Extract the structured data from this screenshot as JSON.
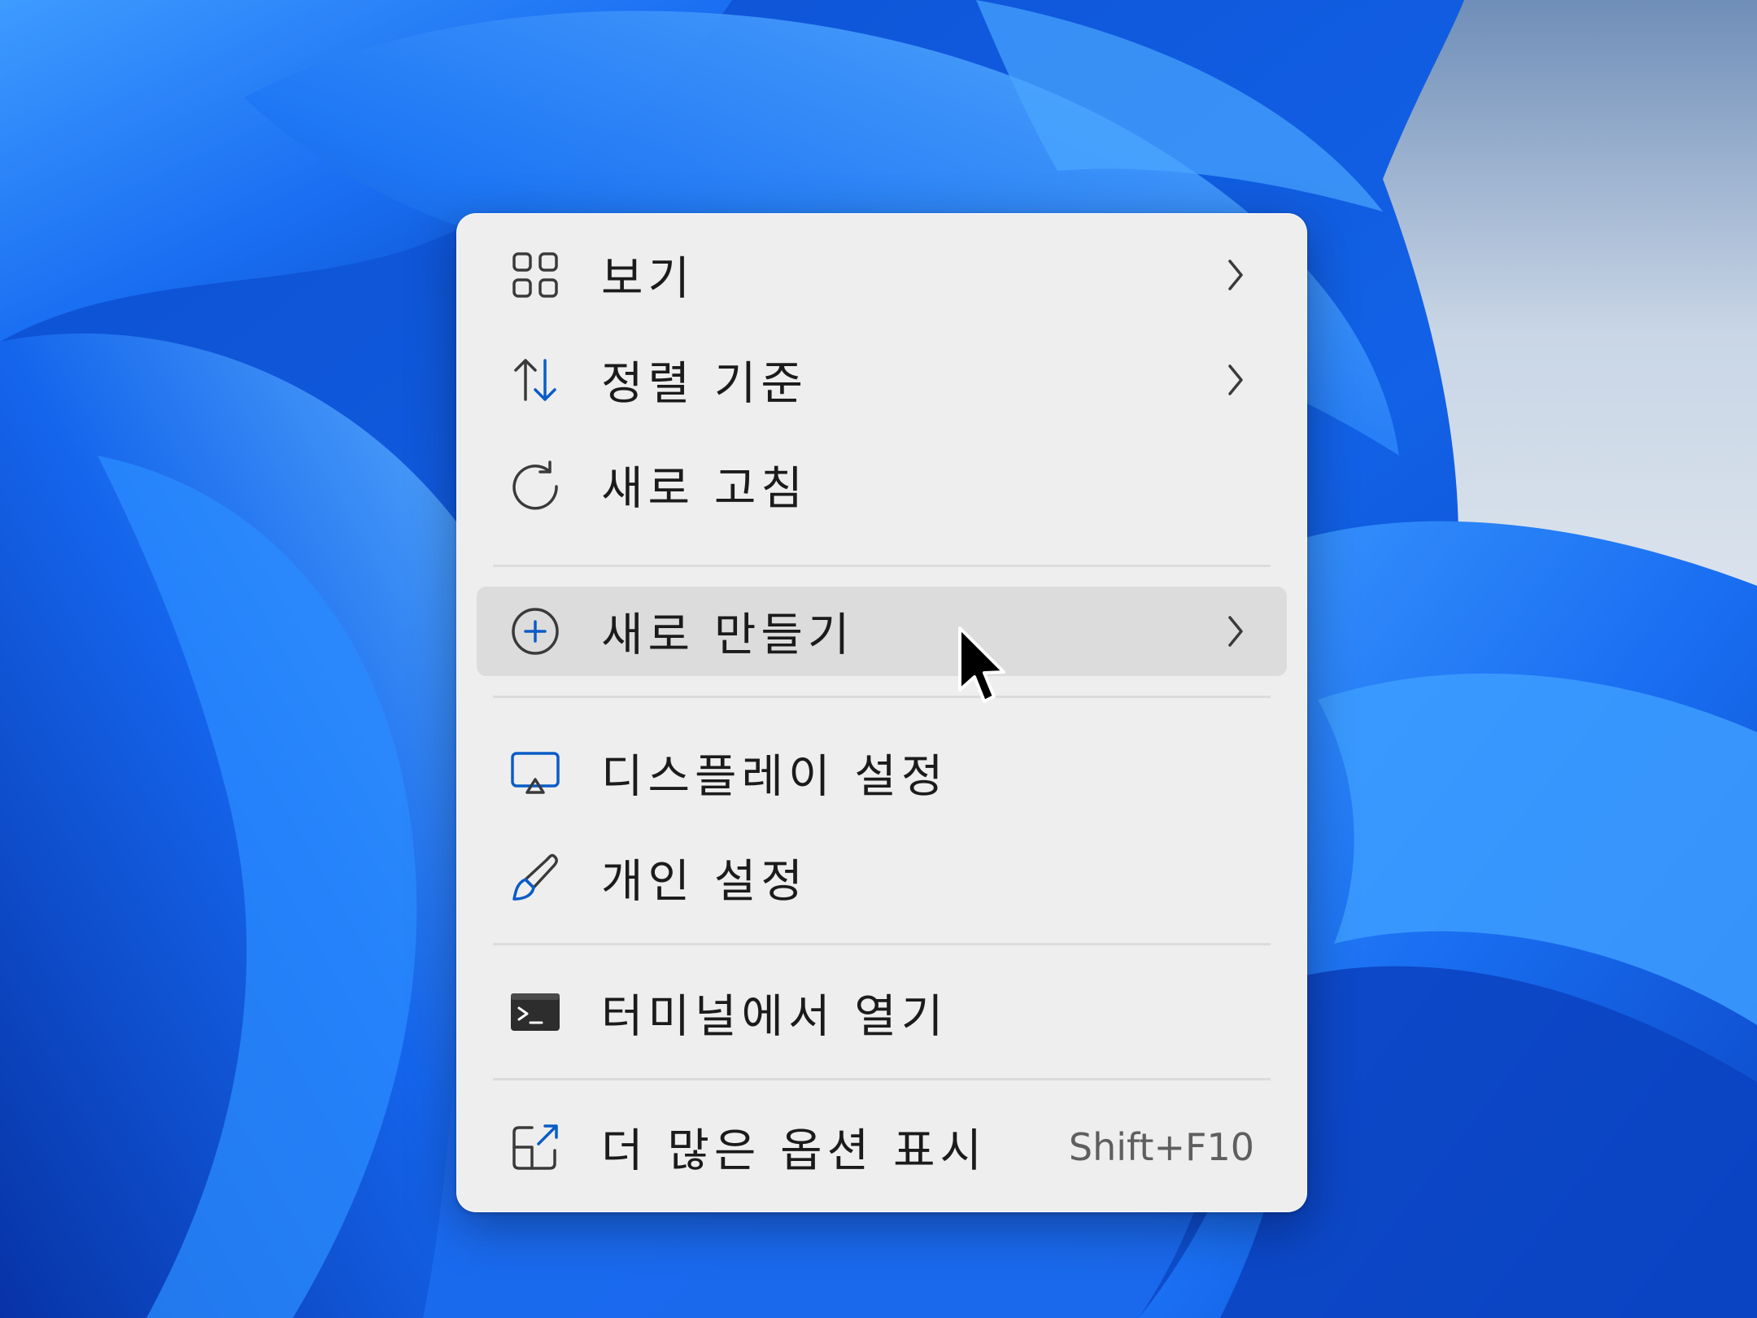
{
  "colors": {
    "menu_background": "#eeeeee",
    "hover_background": "#dcdcdc",
    "text": "#1b1b1b",
    "shortcut_text": "#5f5f5f",
    "accent_blue": "#0a5cc7",
    "wallpaper_blue": "#0b5bdc"
  },
  "context_menu": {
    "items": [
      {
        "label": "보기",
        "icon": "grid-view-icon",
        "has_submenu": true
      },
      {
        "label": "정렬 기준",
        "icon": "sort-arrows-icon",
        "has_submenu": true
      },
      {
        "label": "새로 고침",
        "icon": "refresh-icon",
        "has_submenu": false
      },
      {
        "label": "새로 만들기",
        "icon": "plus-circle-icon",
        "has_submenu": true,
        "hovered": true
      },
      {
        "label": "디스플레이 설정",
        "icon": "monitor-icon",
        "has_submenu": false
      },
      {
        "label": "개인 설정",
        "icon": "paintbrush-icon",
        "has_submenu": false
      },
      {
        "label": "터미널에서 열기",
        "icon": "terminal-icon",
        "has_submenu": false
      },
      {
        "label": "더 많은 옵션 표시",
        "icon": "open-external-icon",
        "has_submenu": false,
        "shortcut": "Shift+F10"
      }
    ]
  }
}
